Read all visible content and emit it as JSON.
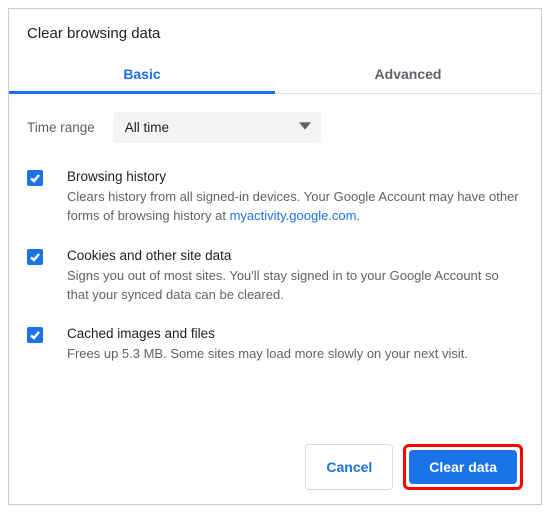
{
  "title": "Clear browsing data",
  "tabs": {
    "basic": "Basic",
    "advanced": "Advanced"
  },
  "time": {
    "label": "Time range",
    "value": "All time"
  },
  "options": [
    {
      "title": "Browsing history",
      "desc_pre": "Clears history from all signed-in devices. Your Google Account may have other forms of browsing history at ",
      "link": "myactivity.google.com",
      "desc_post": "."
    },
    {
      "title": "Cookies and other site data",
      "desc": "Signs you out of most sites. You'll stay signed in to your Google Account so that your synced data can be cleared."
    },
    {
      "title": "Cached images and files",
      "desc": "Frees up 5.3 MB. Some sites may load more slowly on your next visit."
    }
  ],
  "buttons": {
    "cancel": "Cancel",
    "clear": "Clear data"
  }
}
